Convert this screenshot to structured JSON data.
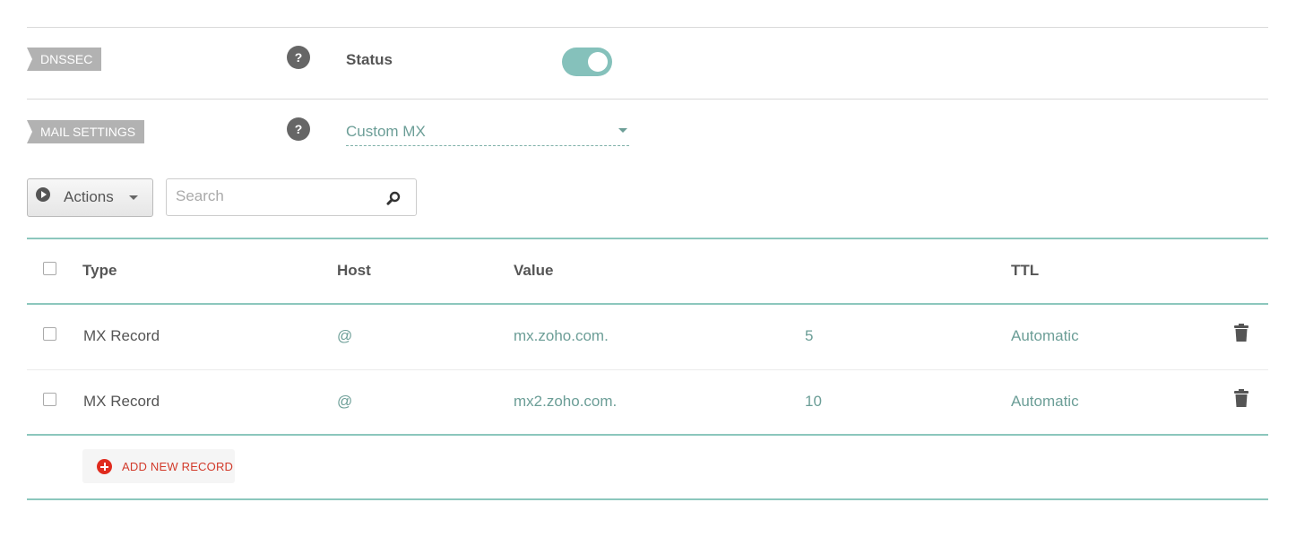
{
  "dnssec": {
    "tag": "DNSSEC",
    "help": "?",
    "status_label": "Status",
    "enabled": true
  },
  "mail_settings": {
    "tag": "MAIL SETTINGS",
    "help": "?",
    "selected": "Custom MX"
  },
  "toolbar": {
    "actions_label": "Actions",
    "search_placeholder": "Search"
  },
  "table": {
    "headers": {
      "type": "Type",
      "host": "Host",
      "value": "Value",
      "ttl": "TTL"
    },
    "rows": [
      {
        "type": "MX Record",
        "host": "@",
        "value": "mx.zoho.com.",
        "priority": "5",
        "ttl": "Automatic"
      },
      {
        "type": "MX Record",
        "host": "@",
        "value": "mx2.zoho.com.",
        "priority": "10",
        "ttl": "Automatic"
      }
    ]
  },
  "add_record_label": "ADD NEW RECORD",
  "colors": {
    "accent_teal": "#85c1bb",
    "teal_text": "#6c9e97",
    "add_red": "#e02b1e",
    "tag_grey": "#b2b2b2"
  }
}
